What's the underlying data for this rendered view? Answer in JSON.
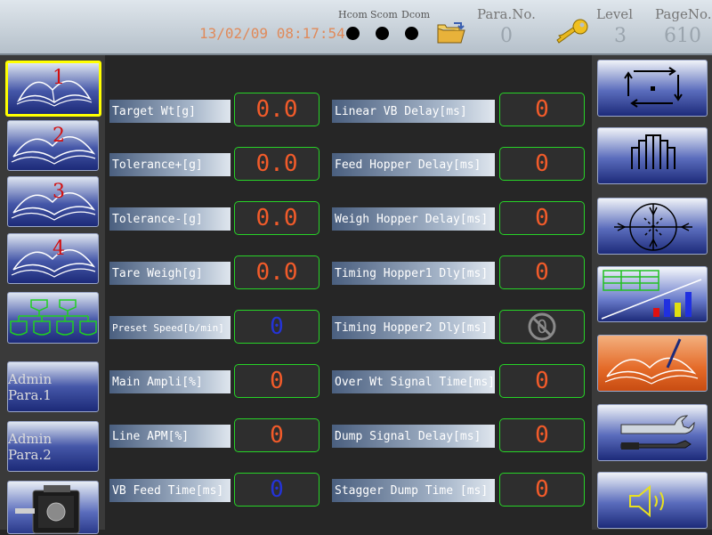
{
  "header": {
    "datetime": "13/02/09 08:17:54",
    "comm": [
      {
        "label": "Hcom"
      },
      {
        "label": "Scom"
      },
      {
        "label": "Dcom"
      }
    ],
    "para_no_label": "Para.No.",
    "para_no_value": "0",
    "level_label": "Level",
    "level_value": "3",
    "page_no_label": "PageNo.",
    "page_no_value": "610"
  },
  "left_nav": {
    "books": [
      {
        "num": "1",
        "active": true
      },
      {
        "num": "2",
        "active": false
      },
      {
        "num": "3",
        "active": false
      },
      {
        "num": "4",
        "active": false
      }
    ],
    "admin1": "Admin Para.1",
    "admin2": "Admin Para.2"
  },
  "params_left": [
    {
      "label": "Target Wt[g]",
      "value": "0.0",
      "color": "orange"
    },
    {
      "label": "Tolerance+[g]",
      "value": "0.0",
      "color": "orange"
    },
    {
      "label": "Tolerance-[g]",
      "value": "0.0",
      "color": "orange"
    },
    {
      "label": "Tare Weigh[g]",
      "value": "0.0",
      "color": "orange"
    },
    {
      "label": "Preset Speed[b/min]",
      "value": "0",
      "color": "blue"
    },
    {
      "label": "Main Ampli[%]",
      "value": "0",
      "color": "orange"
    },
    {
      "label": "Line APM[%]",
      "value": "0",
      "color": "orange"
    },
    {
      "label": "VB Feed Time[ms]",
      "value": "0",
      "color": "blue"
    }
  ],
  "params_right": [
    {
      "label": "Linear VB Delay[ms]",
      "value": "0"
    },
    {
      "label": "Feed Hopper Delay[ms]",
      "value": "0"
    },
    {
      "label": "Weigh Hopper Delay[ms]",
      "value": "0"
    },
    {
      "label": "Timing Hopper1 Dly[ms]",
      "value": "0"
    },
    {
      "label": "Timing Hopper2 Dly[ms]",
      "value": "",
      "disabled": true
    },
    {
      "label": "Over Wt Signal Time[ms]",
      "value": "0"
    },
    {
      "label": "Dump Signal Delay[ms]",
      "value": "0"
    },
    {
      "label": "Stagger Dump Time [ms]",
      "value": "0"
    }
  ],
  "right_toolbar": [
    {
      "icon": "cycle-arrows-icon"
    },
    {
      "icon": "hopper-bank-icon"
    },
    {
      "icon": "calibration-target-icon"
    },
    {
      "icon": "statistics-chart-icon"
    },
    {
      "icon": "edit-book-icon",
      "active": true
    },
    {
      "icon": "tools-icon"
    },
    {
      "icon": "speaker-icon"
    }
  ],
  "colors": {
    "value_orange": "#f25b2a",
    "value_blue": "#2433d6",
    "frame_green": "#27d327",
    "active_yellow": "#ffff00",
    "datetime": "#e08a5a"
  }
}
